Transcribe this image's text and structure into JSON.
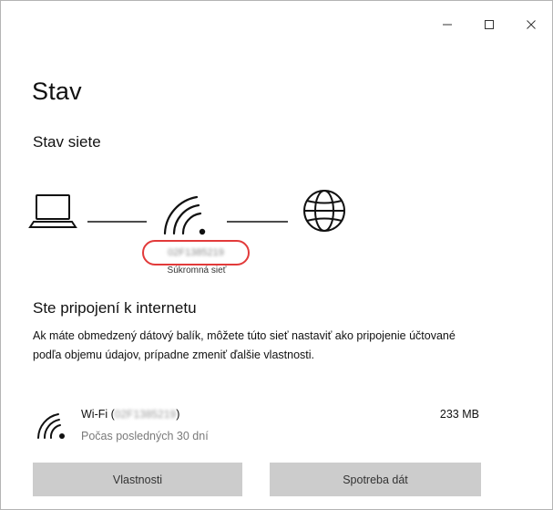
{
  "window": {
    "caption": {
      "minimize_icon": "minimize-icon",
      "maximize_icon": "maximize-icon",
      "close_icon": "close-icon"
    }
  },
  "page": {
    "title": "Stav",
    "section_title": "Stav siete"
  },
  "diagram": {
    "ssid": "02F1385219",
    "network_type": "Súkromná sieť",
    "icons": [
      "laptop-icon",
      "wifi-icon",
      "globe-icon"
    ],
    "highlight_color": "#e23a3a"
  },
  "connection": {
    "heading": "Ste pripojení k internetu",
    "description": "Ak máte obmedzený dátový balík, môžete túto sieť nastaviť ako pripojenie účtované podľa objemu údajov, prípadne zmeniť ďalšie vlastnosti."
  },
  "wifi": {
    "label_prefix": "Wi-Fi (",
    "ssid": "02F1385219",
    "label_suffix": ")",
    "period": "Počas posledných 30 dní",
    "usage": "233 MB"
  },
  "buttons": {
    "properties": "Vlastnosti",
    "data_usage": "Spotreba dát"
  }
}
